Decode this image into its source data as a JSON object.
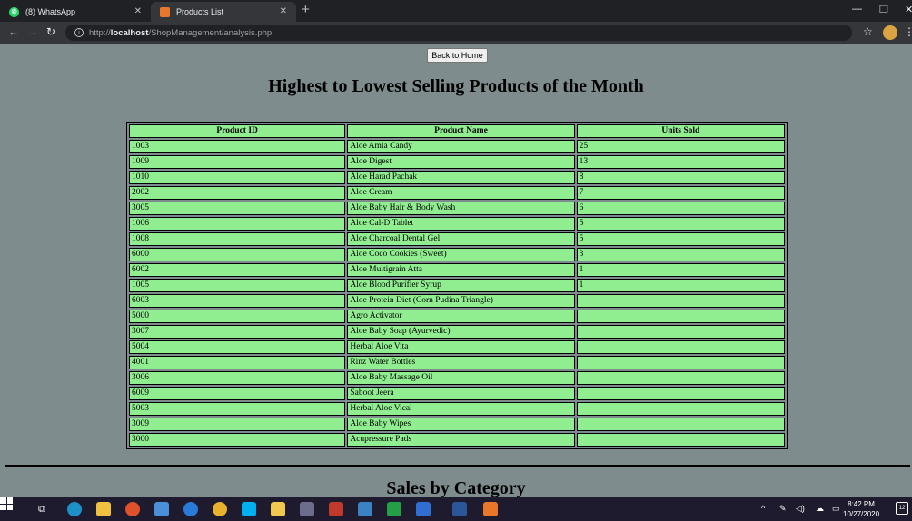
{
  "browser": {
    "tabs": [
      {
        "title": "(8) WhatsApp",
        "active": false
      },
      {
        "title": "Products List",
        "active": true
      }
    ],
    "url_prefix": "http://",
    "url_host": "localhost",
    "url_path": "/ShopManagement/analysis.php"
  },
  "page": {
    "back_button_label": "Back to Home",
    "title": "Highest to Lowest Selling Products of the Month",
    "section_title": "Sales by Category"
  },
  "products_table": {
    "headers": [
      "Product ID",
      "Product Name",
      "Units Sold"
    ],
    "rows": [
      [
        "1003",
        "Aloe Amla Candy",
        "25"
      ],
      [
        "1009",
        "Aloe Digest",
        "13"
      ],
      [
        "1010",
        "Aloe Harad Pachak",
        "8"
      ],
      [
        "2002",
        "Aloe Cream",
        "7"
      ],
      [
        "3005",
        "Aloe Baby Hair & Body Wash",
        "6"
      ],
      [
        "1006",
        "Aloe Cal-D Tablet",
        "5"
      ],
      [
        "1008",
        "Aloe Charcoal Dental Gel",
        "5"
      ],
      [
        "6000",
        "Aloe Coco Cookies (Sweet)",
        "3"
      ],
      [
        "6002",
        "Aloe Multigrain Atta",
        "1"
      ],
      [
        "1005",
        "Aloe Blood Purifier Syrup",
        "1"
      ],
      [
        "6003",
        "Aloe Protein Diet (Corn Pudina Triangle)",
        ""
      ],
      [
        "5000",
        "Agro Activator",
        ""
      ],
      [
        "3007",
        "Aloe Baby Soap (Ayurvedic)",
        ""
      ],
      [
        "5004",
        "Herbal Aloe Vita",
        ""
      ],
      [
        "4001",
        "Rinz Water Bottles",
        ""
      ],
      [
        "3006",
        "Aloe Baby Massage Oil",
        ""
      ],
      [
        "6009",
        "Saboot Jeera",
        ""
      ],
      [
        "5003",
        "Herbal Aloe Vical",
        ""
      ],
      [
        "3009",
        "Aloe Baby Wipes",
        ""
      ],
      [
        "3000",
        "Acupressure Pads",
        ""
      ]
    ]
  },
  "taskbar": {
    "time": "8:42 PM",
    "date": "10/27/2020",
    "notification_count": "12"
  },
  "colors": {
    "page_background": "#7f8c8d",
    "table_cell": "#90ee90"
  }
}
